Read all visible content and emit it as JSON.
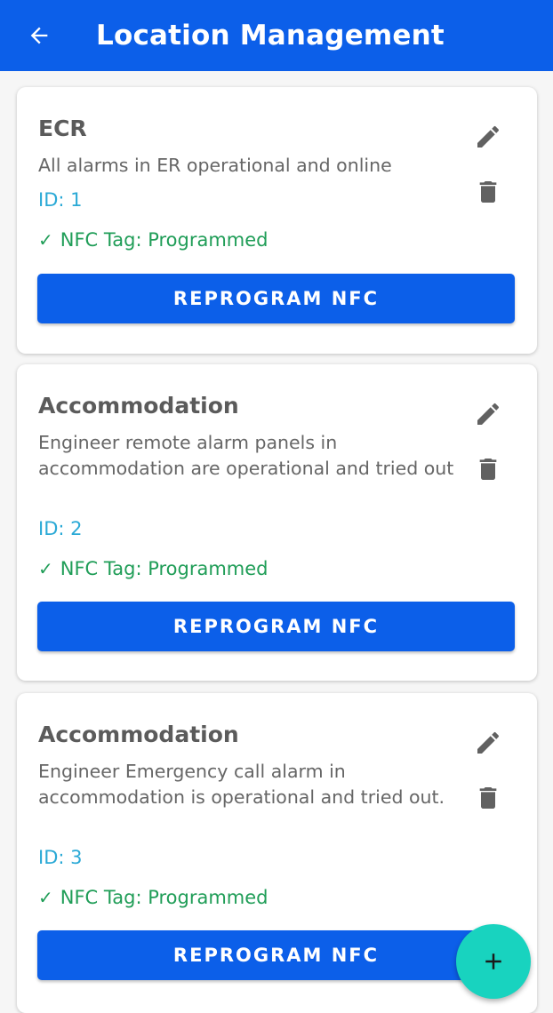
{
  "appbar": {
    "title": "Location Management",
    "back_icon": "arrow-left-icon",
    "color": "#0c5fe9"
  },
  "locations": [
    {
      "title": "ECR",
      "description": "All alarms in ER operational and online",
      "id_label": "ID: 1",
      "nfc_status": "NFC Tag: Programmed",
      "button_label": "REPROGRAM NFC"
    },
    {
      "title": "Accommodation",
      "description": "Engineer remote alarm panels in accommodation are operational and tried out",
      "id_label": "ID: 2",
      "nfc_status": "NFC Tag: Programmed",
      "button_label": "REPROGRAM NFC"
    },
    {
      "title": "Accommodation",
      "description": "Engineer Emergency call alarm in accommodation is operational and tried out.",
      "id_label": "ID: 3",
      "nfc_status": "NFC Tag: Programmed",
      "button_label": "REPROGRAM NFC"
    }
  ],
  "icons": {
    "edit": "pencil-icon",
    "delete": "trash-icon",
    "status": "check-icon",
    "fab": "plus-icon"
  },
  "colors": {
    "primary": "#0c5fe9",
    "fab": "#18d3bf",
    "id_text": "#2aa9d6",
    "status_text": "#1f9d57"
  }
}
